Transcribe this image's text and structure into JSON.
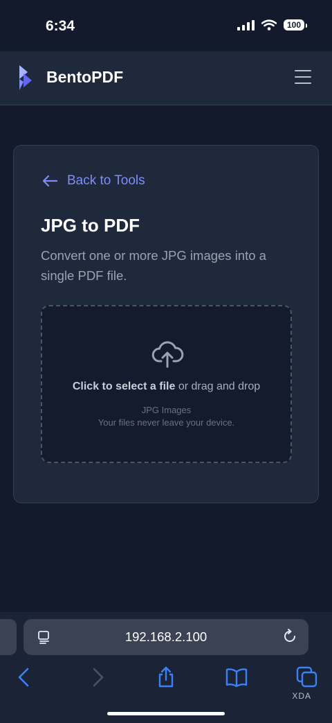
{
  "status_bar": {
    "time": "6:34",
    "battery": "100"
  },
  "header": {
    "brand": "BentoPDF",
    "logo_icon": "bento-logo-icon",
    "menu_icon": "hamburger-menu-icon"
  },
  "tool": {
    "back_label": "Back to Tools",
    "title": "JPG to PDF",
    "description": "Convert one or more JPG images into a single PDF file.",
    "dropzone": {
      "action_strong": "Click to select a file",
      "action_rest": " or drag and drop",
      "file_types": "JPG Images",
      "privacy_note": "Your files never leave your device.",
      "icon": "cloud-upload-icon"
    }
  },
  "browser": {
    "url": "192.168.2.100",
    "icons": [
      "back-icon",
      "forward-icon",
      "share-icon",
      "bookmarks-icon",
      "tabs-icon"
    ]
  },
  "watermark": "XDA",
  "colors": {
    "background": "#121a2b",
    "surface": "#1e293b",
    "accent": "#818cf8",
    "link_blue": "#3b82f6"
  }
}
